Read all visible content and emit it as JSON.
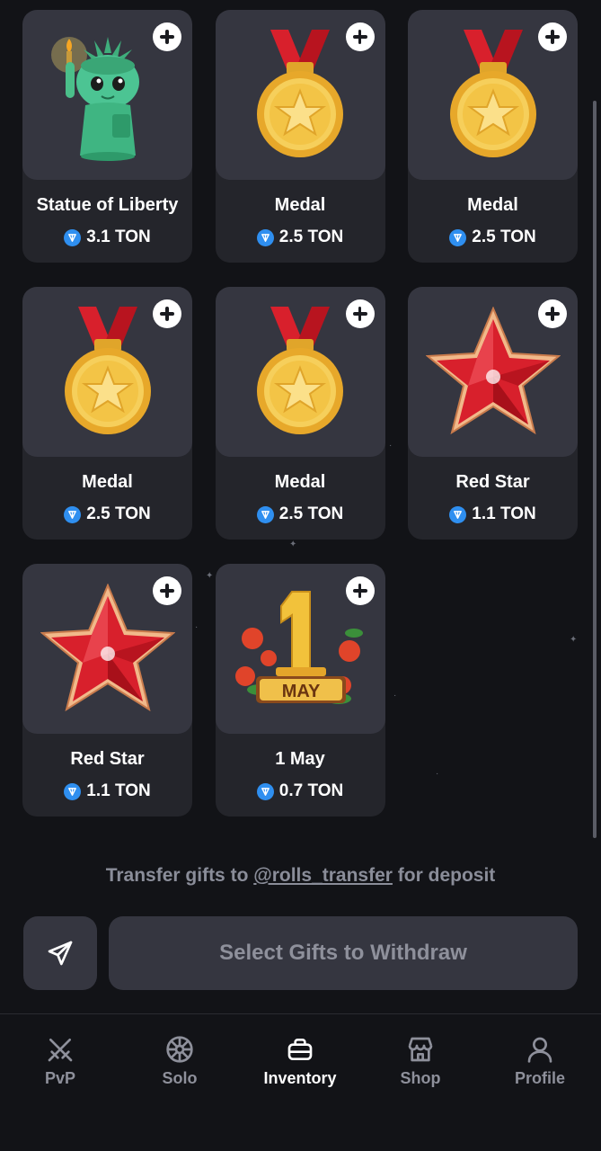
{
  "gifts": [
    {
      "name": "Statue of Liberty",
      "price": "3.1 TON",
      "image": "statue-of-liberty-image"
    },
    {
      "name": "Medal",
      "price": "2.5 TON",
      "image": "medal-image"
    },
    {
      "name": "Medal",
      "price": "2.5 TON",
      "image": "medal-image"
    },
    {
      "name": "Medal",
      "price": "2.5 TON",
      "image": "medal-image"
    },
    {
      "name": "Medal",
      "price": "2.5 TON",
      "image": "medal-image"
    },
    {
      "name": "Red Star",
      "price": "1.1 TON",
      "image": "red-star-image"
    },
    {
      "name": "Red Star",
      "price": "1.1 TON",
      "image": "red-star-image"
    },
    {
      "name": "1 May",
      "price": "0.7 TON",
      "image": "may-day-image"
    }
  ],
  "transfer": {
    "prefix": "Transfer gifts to",
    "handle": "@rolls_transfer",
    "suffix": "for deposit"
  },
  "actions": {
    "send_icon": "send-icon",
    "withdraw_label": "Select Gifts to Withdraw"
  },
  "nav": {
    "items": [
      {
        "label": "PvP",
        "icon": "swords-icon",
        "active": false
      },
      {
        "label": "Solo",
        "icon": "wheel-icon",
        "active": false
      },
      {
        "label": "Inventory",
        "icon": "inventory-icon",
        "active": true
      },
      {
        "label": "Shop",
        "icon": "shop-icon",
        "active": false
      },
      {
        "label": "Profile",
        "icon": "profile-icon",
        "active": false
      }
    ]
  },
  "colors": {
    "background": "#121317",
    "card": "#24252b",
    "card_image": "#353640",
    "ton_blue": "#2f8ff0",
    "muted_text": "#8e909b"
  }
}
